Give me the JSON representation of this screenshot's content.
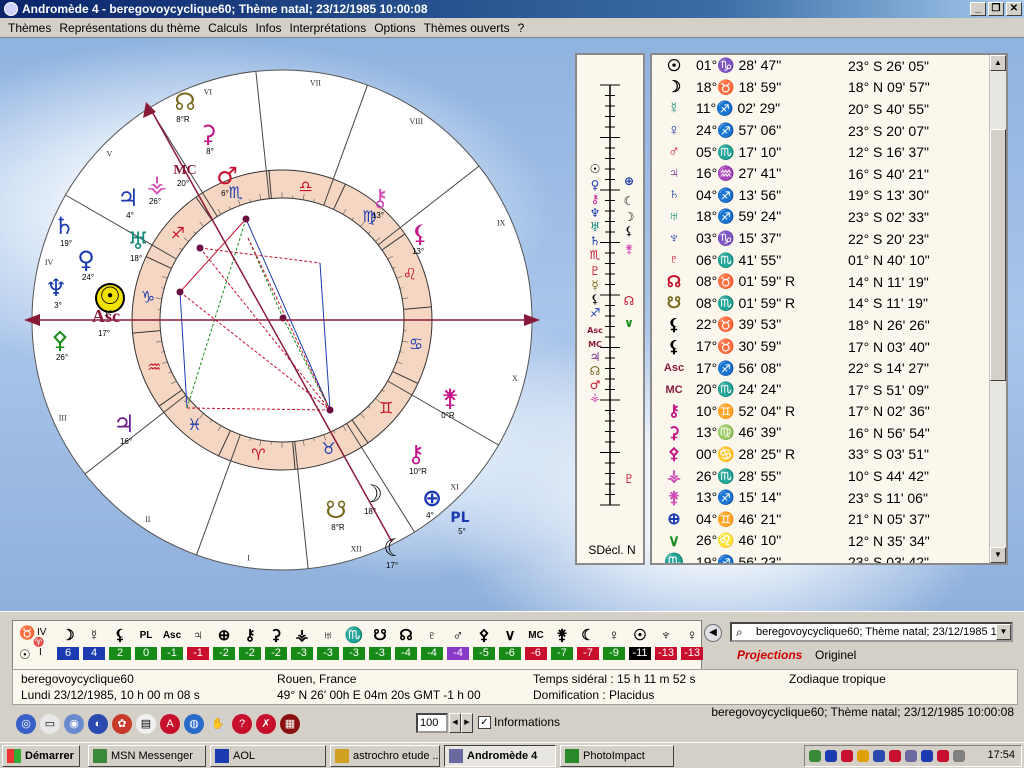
{
  "window": {
    "title": "Andromède 4 - beregovoycyclique60; Thème natal; 23/12/1985 10:00:08"
  },
  "menu": [
    "Thèmes",
    "Représentations du thème",
    "Calculs",
    "Infos",
    "Interprétations",
    "Options",
    "Thèmes ouverts",
    "?"
  ],
  "chart": {
    "signs": [
      "♏",
      "♐",
      "♑",
      "♒",
      "♓",
      "♈",
      "♉",
      "♊",
      "♋",
      "♌",
      "♍",
      "♎"
    ],
    "sign_colors": [
      "#1c3bb0",
      "#c8102e",
      "#1c3bb0",
      "#c8102e",
      "#1c3bb0",
      "#c8102e",
      "#1c3bb0",
      "#c8102e",
      "#1c3bb0",
      "#c8102e",
      "#1c3bb0",
      "#c8102e"
    ],
    "house_labels": [
      "IV",
      "V",
      "VI",
      "VII",
      "VIII",
      "IX",
      "X",
      "XI",
      "XII",
      "I",
      "II",
      "III"
    ],
    "asc_label": "Asc",
    "asc_deg": "17°",
    "mc_label": "MC",
    "mc_deg": "20°",
    "planets": [
      {
        "glyph": "☊",
        "deg": "8°R",
        "color": "#7a6a20"
      },
      {
        "glyph": "⚳",
        "deg": "8°",
        "color": "#c2188a"
      },
      {
        "glyph": "♂",
        "deg": "6°",
        "color": "#c8102e"
      },
      {
        "glyph": "♃",
        "deg": "4°",
        "color": "#1c3bb0"
      },
      {
        "glyph": "⚶",
        "deg": "26°",
        "color": "#d14fb8"
      },
      {
        "glyph": "♄",
        "deg": "19°",
        "color": "#1c3bb0"
      },
      {
        "glyph": "♅",
        "deg": "18°",
        "color": "#138a7a"
      },
      {
        "glyph": "♆",
        "deg": "3°",
        "color": "#1c3bb0"
      },
      {
        "glyph": "☉",
        "deg": "1°",
        "color": "#000000"
      },
      {
        "glyph": "♀",
        "deg": "24°",
        "color": "#1c3bb0"
      },
      {
        "glyph": "⚷",
        "deg": "13°",
        "color": "#d14fb8"
      },
      {
        "glyph": "♃",
        "deg": "16°",
        "color": "#6a1e8a"
      },
      {
        "glyph": "⚸",
        "deg": "13°",
        "color": "#c2188a"
      },
      {
        "glyph": "⚴",
        "deg": "26°",
        "color": "#178a17"
      },
      {
        "glyph": "⚵",
        "deg": "0°R",
        "color": "#c2188a"
      },
      {
        "glyph": "⚷",
        "deg": "10°R",
        "color": "#c2188a"
      },
      {
        "glyph": "⊕",
        "deg": "4°",
        "color": "#1c3bb0"
      },
      {
        "glyph": "PL",
        "deg": "5°",
        "color": "#1c3bb0"
      },
      {
        "glyph": "☽",
        "deg": "18°",
        "color": "#000000"
      },
      {
        "glyph": "☋",
        "deg": "8°R",
        "color": "#7a6a20"
      },
      {
        "glyph": "☾",
        "deg": "17°",
        "color": "#000000"
      }
    ]
  },
  "declination": {
    "label": "SDécl. N"
  },
  "positions": [
    {
      "glyph": "☉",
      "color": "#000000",
      "lon": "01°♑ 28' 47\"",
      "decl": "23° S 26' 05\""
    },
    {
      "glyph": "☽",
      "color": "#000000",
      "lon": "18°♉ 18' 59\"",
      "decl": "18° N 09' 57\""
    },
    {
      "glyph": "☿",
      "color": "#138a7a",
      "lon": "11°♐ 02' 29\"",
      "decl": "20° S 40' 55\""
    },
    {
      "glyph": "♀",
      "color": "#1c3bb0",
      "lon": "24°♐ 57' 06\"",
      "decl": "23° S 20' 07\""
    },
    {
      "glyph": "♂",
      "color": "#c8102e",
      "lon": "05°♏ 17' 10\"",
      "decl": "12° S 16' 37\""
    },
    {
      "glyph": "♃",
      "color": "#6a1e8a",
      "lon": "16°♒ 27' 41\"",
      "decl": "16° S 40' 21\""
    },
    {
      "glyph": "♄",
      "color": "#1c3bb0",
      "lon": "04°♐ 13' 56\"",
      "decl": "19° S 13' 30\""
    },
    {
      "glyph": "♅",
      "color": "#138a7a",
      "lon": "18°♐ 59' 24\"",
      "decl": "23° S 02' 33\""
    },
    {
      "glyph": "♆",
      "color": "#1c3bb0",
      "lon": "03°♑ 15' 37\"",
      "decl": "22° S 20' 23\""
    },
    {
      "glyph": "♇",
      "color": "#c8102e",
      "lon": "06°♏ 41' 55\"",
      "decl": "01° N 40' 10\""
    },
    {
      "glyph": "☊",
      "color": "#c8102e",
      "lon": "08°♉ 01' 59\" R",
      "decl": "14° N 11' 19\""
    },
    {
      "glyph": "☋",
      "color": "#7a6a20",
      "lon": "08°♏ 01' 59\" R",
      "decl": "14° S 11' 19\""
    },
    {
      "glyph": "⚸",
      "color": "#000000",
      "lon": "22°♉ 39' 53\"",
      "decl": "18° N 26' 26\""
    },
    {
      "glyph": "⚸",
      "color": "#000000",
      "lon": "17°♉ 30' 59\"",
      "decl": "17° N 03' 40\""
    },
    {
      "glyph": "Asc",
      "color": "#8a1a3a",
      "lon": "17°♐ 56' 08\"",
      "decl": "22° S 14' 27\""
    },
    {
      "glyph": "MC",
      "color": "#8a1a3a",
      "lon": "20°♏ 24' 24\"",
      "decl": "17° S 51' 09\""
    },
    {
      "glyph": "⚷",
      "color": "#c2188a",
      "lon": "10°♊ 52' 04\" R",
      "decl": "17° N 02' 36\""
    },
    {
      "glyph": "⚳",
      "color": "#c2188a",
      "lon": "13°♍ 46' 39\"",
      "decl": "16° N 56' 54\""
    },
    {
      "glyph": "⚴",
      "color": "#c2188a",
      "lon": "00°♋ 28' 25\" R",
      "decl": "33° S 03' 51\""
    },
    {
      "glyph": "⚶",
      "color": "#d14fb8",
      "lon": "26°♏ 28' 55\"",
      "decl": "10° S 44' 42\""
    },
    {
      "glyph": "⚵",
      "color": "#d14fb8",
      "lon": "13°♐ 15' 14\"",
      "decl": "23° S 11' 06\""
    },
    {
      "glyph": "⊕",
      "color": "#1c3bb0",
      "lon": "04°♊ 46' 21\"",
      "decl": "21° N 05' 37\""
    },
    {
      "glyph": "∨",
      "color": "#178a17",
      "lon": "26°♌ 46' 10\"",
      "decl": "12° N 35' 34\""
    },
    {
      "glyph": "♏",
      "color": "#c8102e",
      "lon": "19°♐ 56' 23\"",
      "decl": "23° S 03' 42\""
    }
  ],
  "aspects_strip": {
    "corner_labels": [
      "IV",
      "I"
    ],
    "items": [
      {
        "glyph": "☽",
        "value": "6",
        "bg": "#1c3bb0"
      },
      {
        "glyph": "☿",
        "value": "4",
        "bg": "#1c3bb0"
      },
      {
        "glyph": "⚸",
        "value": "2",
        "bg": "#178a17"
      },
      {
        "glyph": "PL",
        "value": "0",
        "bg": "#178a17"
      },
      {
        "glyph": "Asc",
        "value": "-1",
        "bg": "#178a17"
      },
      {
        "glyph": "♃",
        "value": "-1",
        "bg": "#c8102e"
      },
      {
        "glyph": "⊕",
        "value": "-2",
        "bg": "#178a17"
      },
      {
        "glyph": "⚷",
        "value": "-2",
        "bg": "#178a17"
      },
      {
        "glyph": "⚳",
        "value": "-2",
        "bg": "#178a17"
      },
      {
        "glyph": "⚶",
        "value": "-3",
        "bg": "#178a17"
      },
      {
        "glyph": "♅",
        "value": "-3",
        "bg": "#178a17"
      },
      {
        "glyph": "♏",
        "value": "-3",
        "bg": "#178a17"
      },
      {
        "glyph": "☋",
        "value": "-3",
        "bg": "#178a17"
      },
      {
        "glyph": "☊",
        "value": "-4",
        "bg": "#178a17"
      },
      {
        "glyph": "♇",
        "value": "-4",
        "bg": "#178a17"
      },
      {
        "glyph": "♂",
        "value": "-4",
        "bg": "#8a3ac8"
      },
      {
        "glyph": "⚴",
        "value": "-5",
        "bg": "#178a17"
      },
      {
        "glyph": "∨",
        "value": "-6",
        "bg": "#178a17"
      },
      {
        "glyph": "MC",
        "value": "-6",
        "bg": "#c8102e"
      },
      {
        "glyph": "⚵",
        "value": "-7",
        "bg": "#178a17"
      },
      {
        "glyph": "☾",
        "value": "-7",
        "bg": "#c8102e"
      },
      {
        "glyph": "♀",
        "value": "-9",
        "bg": "#178a17"
      },
      {
        "glyph": "☉",
        "value": "-11",
        "bg": "#000000"
      },
      {
        "glyph": "♆",
        "value": "-13",
        "bg": "#c8102e"
      },
      {
        "glyph": "♀",
        "value": "-13",
        "bg": "#c8102e"
      }
    ]
  },
  "theme_selector": "beregovoycyclique60; Thème natal; 23/12/1985 10",
  "projections_label": "Projections",
  "originel_label": "Originel",
  "info": {
    "name": "beregovoycyclique60",
    "date": "Lundi 23/12/1985, 10 h 00 m 08 s",
    "place": "Rouen, France",
    "coords": "49° N 26' 00h E 04m 20s GMT -1 h 00",
    "sidereal": "Temps sidéral : 15 h  11 m  52 s",
    "domification": "Domification :  Placidus",
    "zodiac": "Zodiaque tropique"
  },
  "toolbar": {
    "icons": [
      "target-icon",
      "keyboard-icon",
      "globe-icon",
      "moon-icon",
      "flower-icon",
      "page-icon",
      "aspect-a-icon",
      "earth-icon",
      "hand-icon",
      "help-icon",
      "close-icon",
      "table-icon"
    ],
    "zoom_value": "100",
    "informations_label": "Informations"
  },
  "status_theme": "beregovoycyclique60; Thème natal; 23/12/1985 10:00:08",
  "taskbar": {
    "start": "Démarrer",
    "buttons": [
      "MSN Messenger",
      "AOL",
      "astrochro etude ...",
      "Andromède 4",
      "PhotoImpact"
    ],
    "clock": "17:54"
  }
}
